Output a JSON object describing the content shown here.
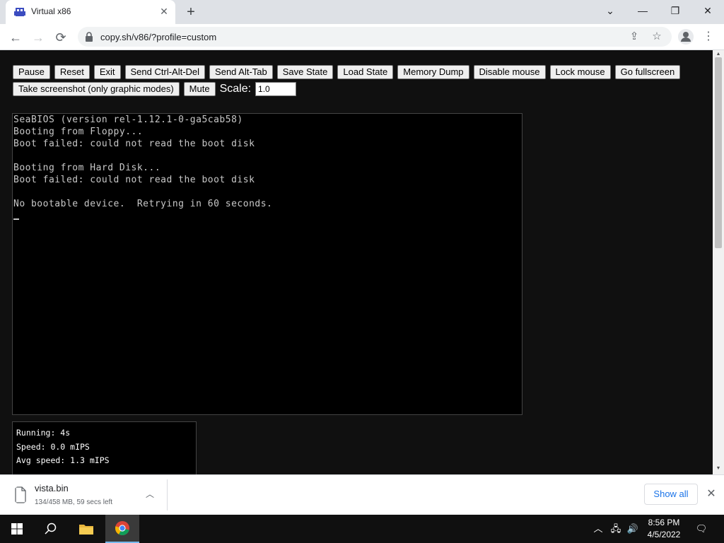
{
  "browser": {
    "tab_title": "Virtual x86",
    "tab_close": "✕",
    "new_tab": "+",
    "url": "copy.sh/v86/?profile=custom",
    "window_controls": {
      "dropdown": "⌄",
      "minimize": "—",
      "restore": "❐",
      "close": "✕"
    }
  },
  "controls": {
    "row1": [
      "Pause",
      "Reset",
      "Exit",
      "Send Ctrl-Alt-Del",
      "Send Alt-Tab",
      "Save State",
      "Load State",
      "Memory Dump",
      "Disable mouse",
      "Lock mouse",
      "Go fullscreen"
    ],
    "screenshot_label": "Take screenshot (only graphic modes)",
    "mute_label": "Mute",
    "scale_label": "Scale:",
    "scale_value": "1.0"
  },
  "screen": {
    "lines": [
      "SeaBIOS (version rel-1.12.1-0-ga5cab58)",
      "Booting from Floppy...",
      "Boot failed: could not read the boot disk",
      "",
      "Booting from Hard Disk...",
      "Boot failed: could not read the boot disk",
      "",
      "No bootable device.  Retrying in 60 seconds."
    ]
  },
  "stats": {
    "running": "Running: 4s",
    "speed": "Speed: 0.0 mIPS",
    "avg_speed": "Avg speed: 1.3 mIPS"
  },
  "download": {
    "file_name": "vista.bin",
    "status": "134/458 MB, 59 secs left",
    "show_all_label": "Show all"
  },
  "taskbar": {
    "time": "8:56 PM",
    "date": "4/5/2022"
  }
}
